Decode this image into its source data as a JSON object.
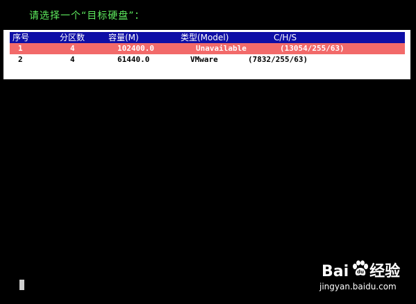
{
  "prompt": "请选择一个“目标硬盘”：",
  "table": {
    "headers": {
      "index": "序号",
      "partitions": "分区数",
      "capacity": "容量(M)",
      "model": "类型(Model)",
      "chs": "C/H/S"
    },
    "rows": [
      {
        "index": "1",
        "partitions": "4",
        "capacity": "102400.0",
        "model": "Unavailable",
        "chs": "(13054/255/63)",
        "selected": true
      },
      {
        "index": "2",
        "partitions": "4",
        "capacity": "61440.0",
        "model": "VMware",
        "chs": "(7832/255/63)",
        "selected": false
      }
    ]
  },
  "watermark": {
    "logo_text_left": "Bai",
    "logo_text_right": "经验",
    "url": "jingyan.baidu.com"
  },
  "colors": {
    "background": "#000000",
    "prompt_text": "#5eea5e",
    "header_bg": "#0e0ea6",
    "selected_row_bg": "#f26a6a",
    "panel_bg": "#ffffff"
  }
}
